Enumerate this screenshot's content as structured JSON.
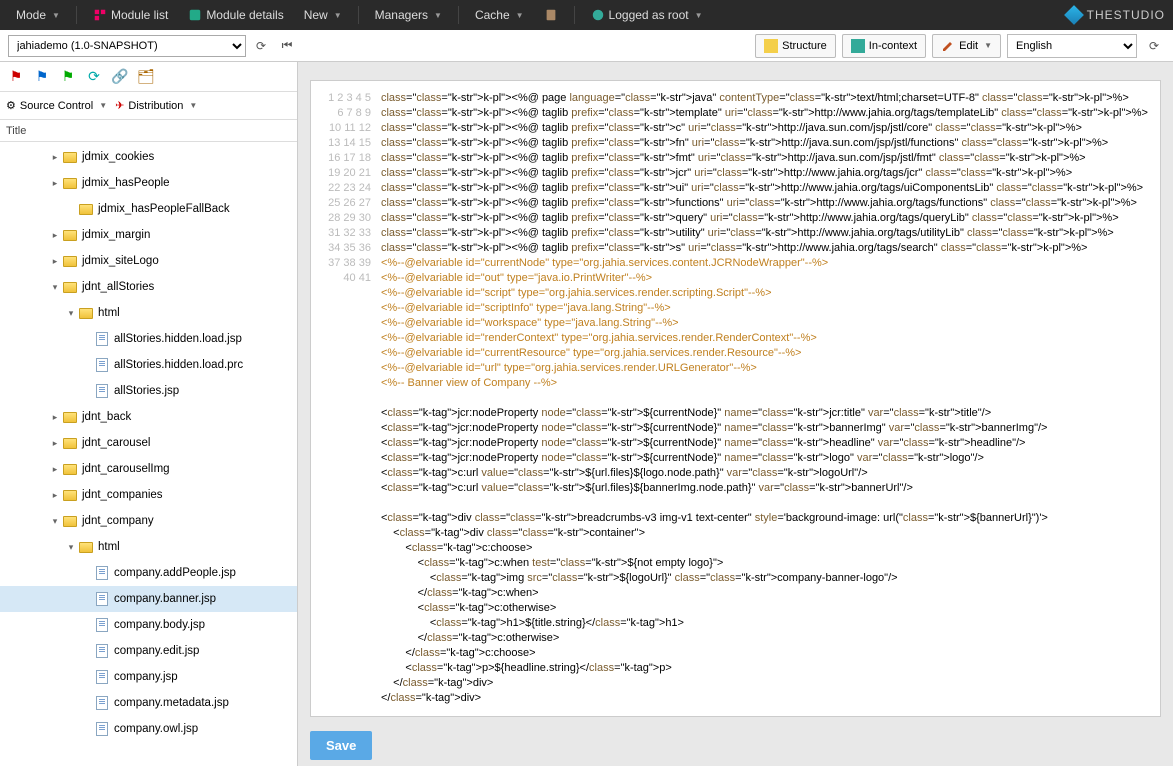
{
  "topbar": {
    "mode": "Mode",
    "module_list": "Module list",
    "module_details": "Module details",
    "new": "New",
    "managers": "Managers",
    "cache": "Cache",
    "logged_as": "Logged as root"
  },
  "logo": {
    "text": "THESTUDIO"
  },
  "module_select": "jahiademo (1.0-SNAPSHOT)",
  "view_buttons": {
    "structure": "Structure",
    "in_context": "In-context",
    "edit": "Edit"
  },
  "language": "English",
  "side_tb2": {
    "source_control": "Source Control",
    "distribution": "Distribution"
  },
  "tree_header": "Title",
  "tree": [
    {
      "indent": 3,
      "toggle": "▸",
      "icon": "folder",
      "label": "jdmix_cookies"
    },
    {
      "indent": 3,
      "toggle": "▸",
      "icon": "folder",
      "label": "jdmix_hasPeople"
    },
    {
      "indent": 4,
      "toggle": "",
      "icon": "folder",
      "label": "jdmix_hasPeopleFallBack"
    },
    {
      "indent": 3,
      "toggle": "▸",
      "icon": "folder",
      "label": "jdmix_margin"
    },
    {
      "indent": 3,
      "toggle": "▸",
      "icon": "folder",
      "label": "jdmix_siteLogo"
    },
    {
      "indent": 3,
      "toggle": "▾",
      "icon": "folder",
      "label": "jdnt_allStories"
    },
    {
      "indent": 4,
      "toggle": "▾",
      "icon": "folder",
      "label": "html"
    },
    {
      "indent": 5,
      "toggle": "",
      "icon": "file",
      "label": "allStories.hidden.load.jsp"
    },
    {
      "indent": 5,
      "toggle": "",
      "icon": "file",
      "label": "allStories.hidden.load.prc"
    },
    {
      "indent": 5,
      "toggle": "",
      "icon": "file",
      "label": "allStories.jsp"
    },
    {
      "indent": 3,
      "toggle": "▸",
      "icon": "folder",
      "label": "jdnt_back"
    },
    {
      "indent": 3,
      "toggle": "▸",
      "icon": "folder",
      "label": "jdnt_carousel"
    },
    {
      "indent": 3,
      "toggle": "▸",
      "icon": "folder",
      "label": "jdnt_carouselImg"
    },
    {
      "indent": 3,
      "toggle": "▸",
      "icon": "folder",
      "label": "jdnt_companies"
    },
    {
      "indent": 3,
      "toggle": "▾",
      "icon": "folder",
      "label": "jdnt_company"
    },
    {
      "indent": 4,
      "toggle": "▾",
      "icon": "folder",
      "label": "html"
    },
    {
      "indent": 5,
      "toggle": "",
      "icon": "file",
      "label": "company.addPeople.jsp"
    },
    {
      "indent": 5,
      "toggle": "",
      "icon": "file",
      "label": "company.banner.jsp",
      "selected": true
    },
    {
      "indent": 5,
      "toggle": "",
      "icon": "file",
      "label": "company.body.jsp"
    },
    {
      "indent": 5,
      "toggle": "",
      "icon": "file",
      "label": "company.edit.jsp"
    },
    {
      "indent": 5,
      "toggle": "",
      "icon": "file",
      "label": "company.jsp"
    },
    {
      "indent": 5,
      "toggle": "",
      "icon": "file",
      "label": "company.metadata.jsp"
    },
    {
      "indent": 5,
      "toggle": "",
      "icon": "file",
      "label": "company.owl.jsp"
    }
  ],
  "code_lines": [
    "<%@ page language=\"java\" contentType=\"text/html;charset=UTF-8\" %>",
    "<%@ taglib prefix=\"template\" uri=\"http://www.jahia.org/tags/templateLib\" %>",
    "<%@ taglib prefix=\"c\" uri=\"http://java.sun.com/jsp/jstl/core\" %>",
    "<%@ taglib prefix=\"fn\" uri=\"http://java.sun.com/jsp/jstl/functions\" %>",
    "<%@ taglib prefix=\"fmt\" uri=\"http://java.sun.com/jsp/jstl/fmt\" %>",
    "<%@ taglib prefix=\"jcr\" uri=\"http://www.jahia.org/tags/jcr\" %>",
    "<%@ taglib prefix=\"ui\" uri=\"http://www.jahia.org/tags/uiComponentsLib\" %>",
    "<%@ taglib prefix=\"functions\" uri=\"http://www.jahia.org/tags/functions\" %>",
    "<%@ taglib prefix=\"query\" uri=\"http://www.jahia.org/tags/queryLib\" %>",
    "<%@ taglib prefix=\"utility\" uri=\"http://www.jahia.org/tags/utilityLib\" %>",
    "<%@ taglib prefix=\"s\" uri=\"http://www.jahia.org/tags/search\" %>",
    "<%--@elvariable id=\"currentNode\" type=\"org.jahia.services.content.JCRNodeWrapper\"--%>",
    "<%--@elvariable id=\"out\" type=\"java.io.PrintWriter\"--%>",
    "<%--@elvariable id=\"script\" type=\"org.jahia.services.render.scripting.Script\"--%>",
    "<%--@elvariable id=\"scriptInfo\" type=\"java.lang.String\"--%>",
    "<%--@elvariable id=\"workspace\" type=\"java.lang.String\"--%>",
    "<%--@elvariable id=\"renderContext\" type=\"org.jahia.services.render.RenderContext\"--%>",
    "<%--@elvariable id=\"currentResource\" type=\"org.jahia.services.render.Resource\"--%>",
    "<%--@elvariable id=\"url\" type=\"org.jahia.services.render.URLGenerator\"--%>",
    "<%-- Banner view of Company --%>",
    "",
    "<jcr:nodeProperty node=\"${currentNode}\" name=\"jcr:title\" var=\"title\"/>",
    "<jcr:nodeProperty node=\"${currentNode}\" name=\"bannerImg\" var=\"bannerImg\"/>",
    "<jcr:nodeProperty node=\"${currentNode}\" name=\"headline\" var=\"headline\"/>",
    "<jcr:nodeProperty node=\"${currentNode}\" name=\"logo\" var=\"logo\"/>",
    "<c:url value=\"${url.files}${logo.node.path}\" var=\"logoUrl\"/>",
    "<c:url value=\"${url.files}${bannerImg.node.path}\" var=\"bannerUrl\"/>",
    "",
    "<div class=\"breadcrumbs-v3 img-v1 text-center\" style='background-image: url(\"${bannerUrl}\")'>",
    "    <div class=\"container\">",
    "        <c:choose>",
    "            <c:when test=\"${not empty logo}\">",
    "                <img src=\"${logoUrl}\" class=\"company-banner-logo\"/>",
    "            </c:when>",
    "            <c:otherwise>",
    "                <h1>${title.string}</h1>",
    "            </c:otherwise>",
    "        </c:choose>",
    "        <p>${headline.string}</p>",
    "    </div>",
    "</div>"
  ],
  "save_label": "Save"
}
